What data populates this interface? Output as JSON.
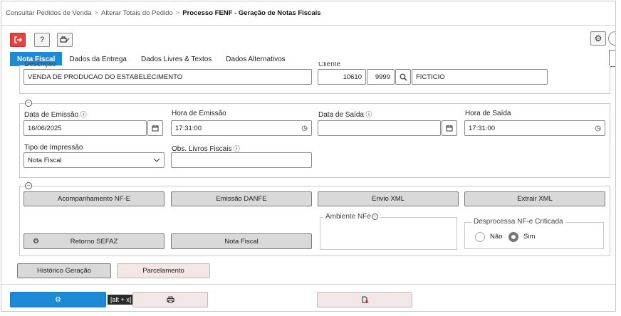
{
  "breadcrumb": {
    "item1": "Consultar Pedidos de Venda",
    "sep": ">",
    "item2": "Alterar Totais do Pedido",
    "current": "Processo FENF - Geração de Notas Fiscais"
  },
  "toolbar": {
    "exit_icon": "exit-icon",
    "help_label": "?",
    "sign_icon": "signature-icon",
    "settings_icon": "gear-icon"
  },
  "tabs": [
    "Nota Fiscal",
    "Dados da Entrega",
    "Dados Livres & Textos",
    "Dados Alternativos"
  ],
  "top_section": {
    "descricao_label": "Descrição",
    "descricao_value": "VENDA DE PRODUCAO DO ESTABELECIMENTO",
    "cliente_label": "Cliente",
    "cliente_code": "10610",
    "cliente_filial": "9999",
    "cliente_name": "FICTICIO"
  },
  "dates": {
    "data_emissao_label": "Data de Emissão",
    "data_emissao_value": "16/06/2025",
    "hora_emissao_label": "Hora de Emissão",
    "hora_emissao_value": "17:31:00",
    "data_saida_label": "Data de Saída",
    "data_saida_value": "",
    "hora_saida_label": "Hora de Saída",
    "hora_saida_value": "17:31:00",
    "tipo_impressao_label": "Tipo de Impressão",
    "tipo_impressao_value": "Nota Fiscal",
    "obs_livros_label": "Obs. Livros Fiscais",
    "obs_livros_value": ""
  },
  "actions": {
    "acompanhamento": "Acompanhamento NF-E",
    "emissao_danfe": "Emissão DANFE",
    "envio_xml": "Envio XML",
    "extrair_xml": "Extrair XML",
    "retorno_sefaz": "Retorno SEFAZ",
    "nota_fiscal": "Nota Fiscal",
    "ambiente_legend": "Ambiente NFe",
    "desprocessa_legend": "Desprocessa NF-e Criticada",
    "nao_label": "Não",
    "sim_label": "Sim",
    "selected_option": "Sim"
  },
  "bottom": {
    "historico": "Histórico Geração",
    "parcelamento": "Parcelamento",
    "tooltip": "[alt + x]"
  },
  "colors": {
    "accent": "#1e8ad6",
    "exit_red": "#e8403a",
    "button_gray": "#d9d9d9",
    "button_pink": "#f3e6e6"
  }
}
